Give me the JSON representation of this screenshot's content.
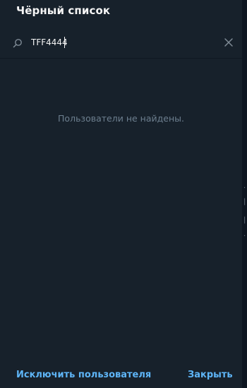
{
  "dialog": {
    "title": "Чёрный список"
  },
  "search": {
    "value": "TFF4444",
    "icon": "search-icon",
    "clear_icon": "close-icon"
  },
  "empty_state": {
    "text": "Пользователи не найдены."
  },
  "footer": {
    "exclude_label": "Исключить пользователя",
    "close_label": "Закрыть"
  },
  "colors": {
    "dialog_bg": "#17212b",
    "backdrop": "#0e1621",
    "accent": "#5eb5f7",
    "muted_text": "#6d7f8f",
    "title_text": "#f5f5f5"
  }
}
